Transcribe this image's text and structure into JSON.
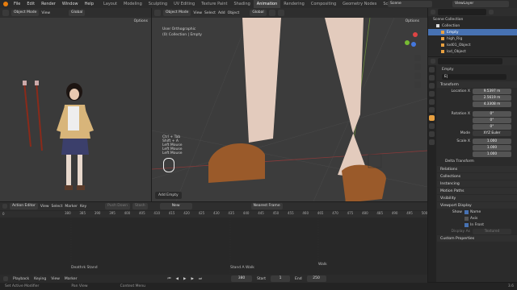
{
  "menu": [
    "File",
    "Edit",
    "Render",
    "Window",
    "Help"
  ],
  "workspaces": [
    "Layout",
    "Modeling",
    "Sculpting",
    "UV Editing",
    "Texture Paint",
    "Shading",
    "Animation",
    "Rendering",
    "Compositing",
    "Geometry Nodes",
    "Scripting"
  ],
  "active_workspace": "Animation",
  "scene": "Scene",
  "view_layer": "ViewLayer",
  "left_view": {
    "mode": "Object Mode",
    "menus": [
      "View"
    ],
    "orient": "Global",
    "options": "Options"
  },
  "main_view": {
    "mode": "Object Mode",
    "menus": [
      "View",
      "Select",
      "Add",
      "Object"
    ],
    "orient": "Global",
    "options": "Options",
    "info1": "User Orthographic",
    "info2": "(0) Collection | Empty",
    "keys": [
      "Ctrl + Tab",
      "Shift + A",
      "Left Mouse",
      "Left Mouse",
      "Left Mouse"
    ],
    "last_op": "Add Empty"
  },
  "outliner": {
    "title": "Scene Collection",
    "items": [
      {
        "label": "Collection",
        "indent": 1
      },
      {
        "label": "Empty",
        "indent": 2,
        "selected": true
      },
      {
        "label": "high_Rig",
        "indent": 2
      },
      {
        "label": "lod01_Object",
        "indent": 2
      },
      {
        "label": "lod_Object",
        "indent": 2
      }
    ]
  },
  "props": {
    "object_name": "Empty",
    "name_field": "E|",
    "transform": "Transform",
    "location": {
      "label": "Location X",
      "x": "9.5397 m",
      "y": "2.5619 m",
      "z": "4.3308 m"
    },
    "rotation": {
      "label": "Rotation X",
      "x": "0°",
      "y": "0°",
      "z": "0°"
    },
    "mode_label": "Mode",
    "mode": "XYZ Euler",
    "scale": {
      "label": "Scale X",
      "x": "1.000",
      "y": "1.000",
      "z": "1.000"
    },
    "delta": "Delta Transform",
    "sections": [
      "Relations",
      "Collections",
      "Instancing",
      "Motion Paths",
      "Visibility",
      "Viewport Display"
    ],
    "show_label": "Show",
    "checks": [
      "Name",
      "Axis",
      "In Front"
    ],
    "display_as_label": "Display As",
    "display_as": "Textured",
    "custom": "Custom Properties"
  },
  "timeline": {
    "editor": "Action Editor",
    "menus": [
      "View",
      "Select",
      "Marker",
      "Key"
    ],
    "push": "Push Down",
    "stash": "Stash",
    "new": "New",
    "frame": "0",
    "sync": "Nearest Frame",
    "ticks": [
      "380",
      "385",
      "390",
      "395",
      "400",
      "405",
      "410",
      "415",
      "420",
      "425",
      "430",
      "435",
      "440",
      "445",
      "450",
      "455",
      "460",
      "465",
      "470",
      "475",
      "480",
      "485",
      "490",
      "495",
      "500"
    ],
    "markers": [
      "Deathrk Stand",
      "Stand A Walk",
      "Walk"
    ]
  },
  "playback": {
    "items": [
      "Playback",
      "Keying",
      "View",
      "Marker"
    ],
    "start_label": "Start",
    "start": "1",
    "end_label": "End",
    "end": "250",
    "current": "380"
  },
  "status": {
    "a": "Set Active Modifier",
    "b": "Pan View",
    "c": "Context Menu",
    "version": "3.6"
  }
}
